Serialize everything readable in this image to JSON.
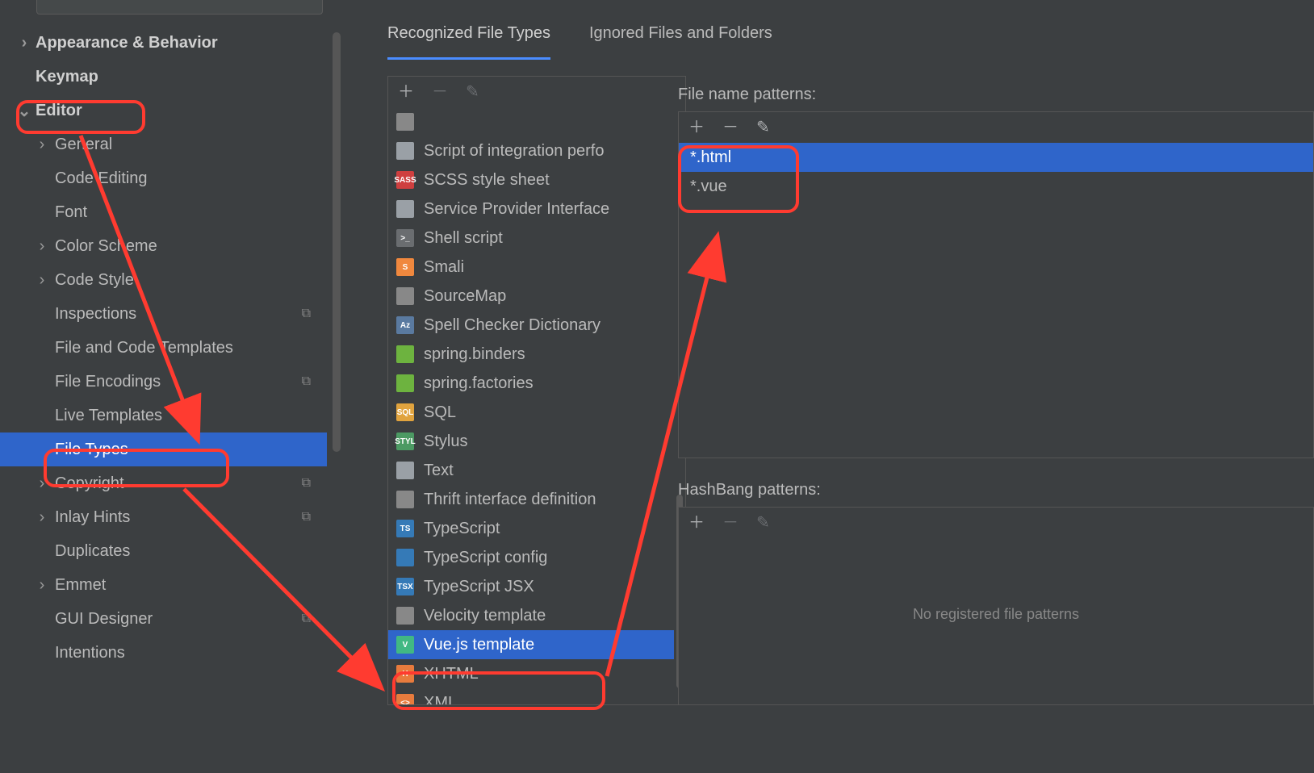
{
  "sidebar": {
    "items": [
      {
        "label": "Appearance & Behavior",
        "chev": "›",
        "bold": true
      },
      {
        "label": "Keymap",
        "chev": "",
        "bold": true
      },
      {
        "label": "Editor",
        "chev": "⌄",
        "bold": true
      },
      {
        "label": "General",
        "chev": "›",
        "lvl": 1
      },
      {
        "label": "Code Editing",
        "chev": "",
        "lvl": 1
      },
      {
        "label": "Font",
        "chev": "",
        "lvl": 1
      },
      {
        "label": "Color Scheme",
        "chev": "›",
        "lvl": 1
      },
      {
        "label": "Code Style",
        "chev": "›",
        "lvl": 1
      },
      {
        "label": "Inspections",
        "chev": "",
        "lvl": 1,
        "copy": true
      },
      {
        "label": "File and Code Templates",
        "chev": "",
        "lvl": 1
      },
      {
        "label": "File Encodings",
        "chev": "",
        "lvl": 1,
        "copy": true
      },
      {
        "label": "Live Templates",
        "chev": "",
        "lvl": 1
      },
      {
        "label": "File Types",
        "chev": "",
        "lvl": 1,
        "selected": true
      },
      {
        "label": "Copyright",
        "chev": "›",
        "lvl": 1,
        "copy": true
      },
      {
        "label": "Inlay Hints",
        "chev": "›",
        "lvl": 1,
        "copy": true
      },
      {
        "label": "Duplicates",
        "chev": "",
        "lvl": 1
      },
      {
        "label": "Emmet",
        "chev": "›",
        "lvl": 1
      },
      {
        "label": "GUI Designer",
        "chev": "",
        "lvl": 1,
        "copy": true
      },
      {
        "label": "Intentions",
        "chev": "",
        "lvl": 1
      }
    ]
  },
  "tabs": {
    "recognized": "Recognized File Types",
    "ignored": "Ignored Files and Folders"
  },
  "filetypes": [
    {
      "label": "",
      "color": "#888"
    },
    {
      "label": "Script of integration perfo",
      "color": "#9aa0a6",
      "text": ""
    },
    {
      "label": "SCSS style sheet",
      "color": "#cf3f3f",
      "text": "SASS"
    },
    {
      "label": "Service Provider Interface",
      "color": "#9aa0a6",
      "text": ""
    },
    {
      "label": "Shell script",
      "color": "#6a6d70",
      "text": ">_"
    },
    {
      "label": "Smali",
      "color": "#f0883e",
      "text": "S"
    },
    {
      "label": "SourceMap",
      "color": "#888",
      "text": ""
    },
    {
      "label": "Spell Checker Dictionary",
      "color": "#5a7aa0",
      "text": "Az"
    },
    {
      "label": "spring.binders",
      "color": "#6db33f",
      "text": ""
    },
    {
      "label": "spring.factories",
      "color": "#6db33f",
      "text": ""
    },
    {
      "label": "SQL",
      "color": "#e0a33e",
      "text": "SQL"
    },
    {
      "label": "Stylus",
      "color": "#4c9a63",
      "text": "STYL"
    },
    {
      "label": "Text",
      "color": "#9aa0a6",
      "text": ""
    },
    {
      "label": "Thrift interface definition",
      "color": "#888",
      "text": ""
    },
    {
      "label": "TypeScript",
      "color": "#357ab7",
      "text": "TS"
    },
    {
      "label": "TypeScript config",
      "color": "#357ab7",
      "text": ""
    },
    {
      "label": "TypeScript JSX",
      "color": "#357ab7",
      "text": "TSX"
    },
    {
      "label": "Velocity template",
      "color": "#888",
      "text": ""
    },
    {
      "label": "Vue.js template",
      "color": "#41b883",
      "text": "V",
      "selected": true
    },
    {
      "label": "XHTML",
      "color": "#e87b3d",
      "text": "H"
    },
    {
      "label": "XML",
      "color": "#e87b3d",
      "text": "<>"
    }
  ],
  "patterns": {
    "label": "File name patterns:",
    "items": [
      {
        "label": "*.html",
        "selected": true
      },
      {
        "label": "*.vue"
      }
    ]
  },
  "hashbang": {
    "label": "HashBang patterns:",
    "empty": "No registered file patterns"
  }
}
